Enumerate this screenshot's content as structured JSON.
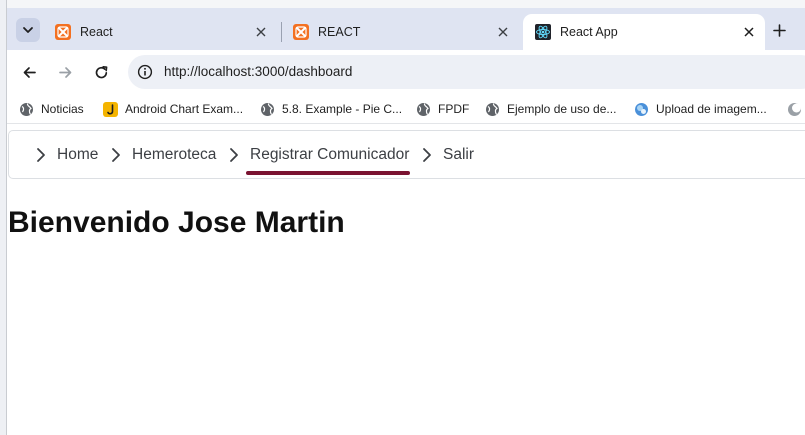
{
  "browser": {
    "tabs": [
      {
        "title": "React",
        "active": false
      },
      {
        "title": "REACT",
        "active": false
      },
      {
        "title": "React App",
        "active": true
      }
    ],
    "address_bar": {
      "url": "http://localhost:3000/dashboard"
    },
    "bookmarks": [
      {
        "label": "Noticias",
        "icon": "globe-icon"
      },
      {
        "label": "Android Chart Exam...",
        "icon": "bookmark-j-icon"
      },
      {
        "label": "5.8. Example - Pie C...",
        "icon": "globe-icon"
      },
      {
        "label": "FPDF",
        "icon": "globe-icon"
      },
      {
        "label": "Ejemplo de uso de...",
        "icon": "globe-icon"
      },
      {
        "label": "Upload de imagem...",
        "icon": "upload-icon"
      }
    ]
  },
  "app": {
    "nav": [
      {
        "label": "Home"
      },
      {
        "label": "Hemeroteca"
      },
      {
        "label": "Registrar Comunicador",
        "active": true
      },
      {
        "label": "Salir"
      }
    ],
    "welcome_heading": "Bienvenido Jose Martin"
  },
  "colors": {
    "accent_underline": "#7a1331",
    "tabstrip": "#dfe4f2",
    "omnibox": "#edf0f6"
  }
}
